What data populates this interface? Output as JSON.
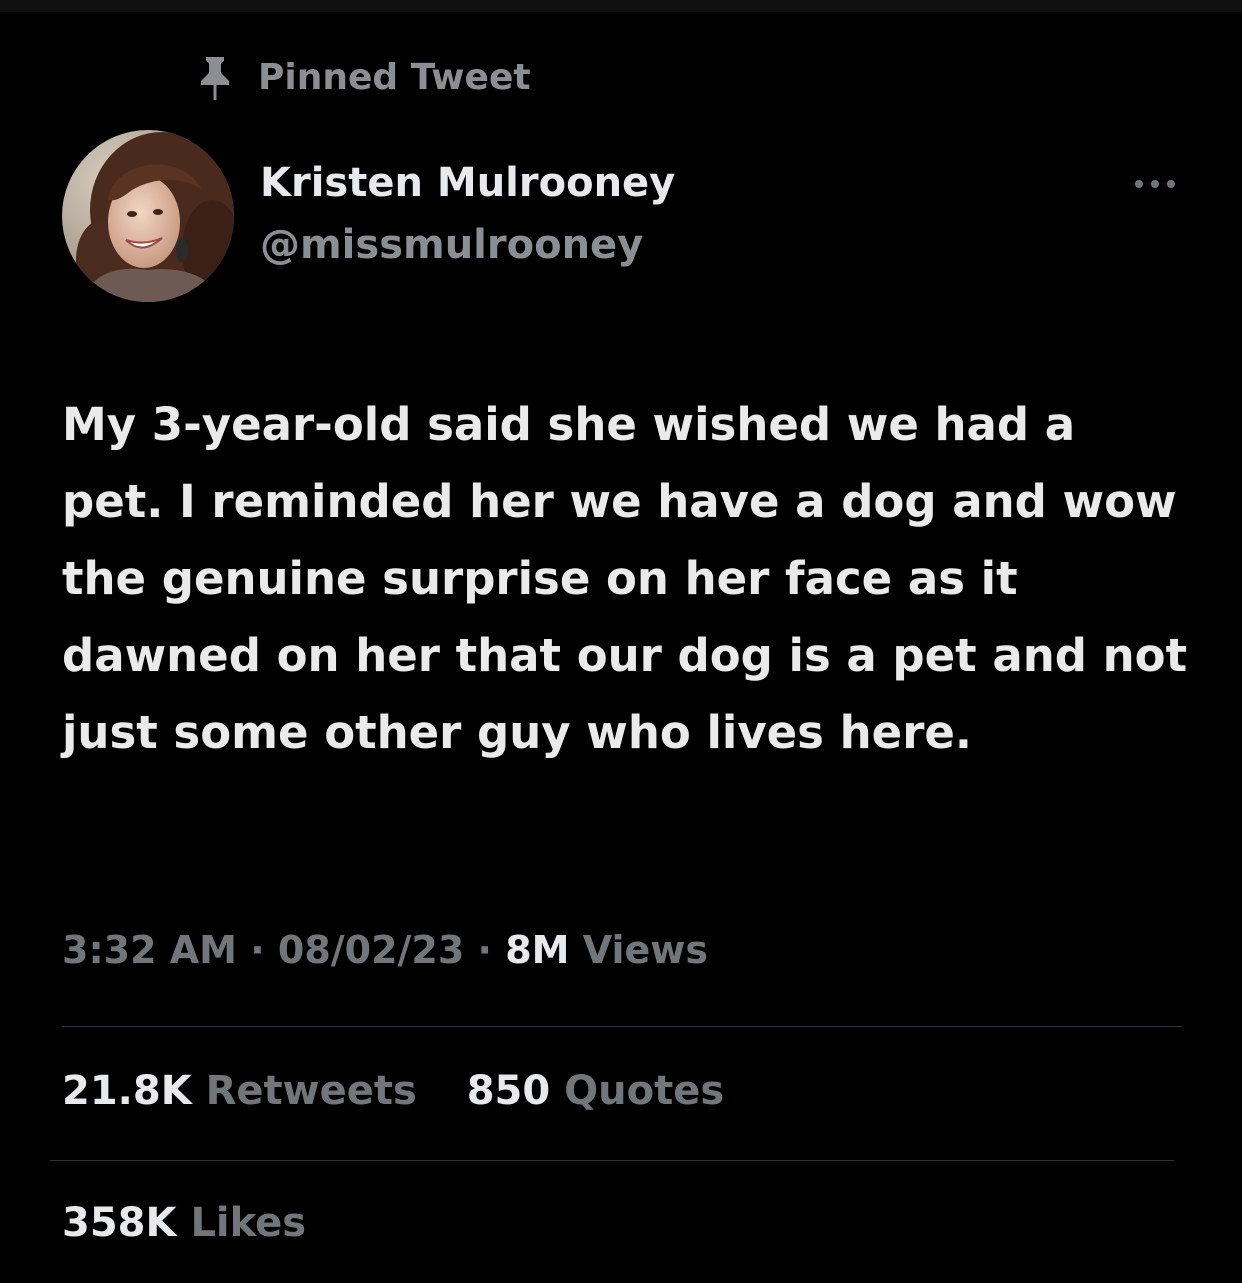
{
  "pinned": {
    "label": "Pinned Tweet",
    "icon": "pin-icon"
  },
  "author": {
    "name": "Kristen Mulrooney",
    "handle": "@missmulrooney",
    "avatar": "avatar-photo"
  },
  "more_icon": "more-icon",
  "tweet": {
    "text": "My 3-year-old said she wished we had a pet. I reminded her we have a dog and wow the genuine surprise on her face as it dawned on her that our dog is a pet and not just some other guy who lives here."
  },
  "meta": {
    "time": "3:32 AM",
    "separator": "·",
    "date": "08/02/23",
    "views_count": "8M",
    "views_label": "Views"
  },
  "stats": {
    "retweets_count": "21.8K",
    "retweets_label": "Retweets",
    "quotes_count": "850",
    "quotes_label": "Quotes",
    "likes_count": "358K",
    "likes_label": "Likes"
  },
  "colors": {
    "background": "#000000",
    "primary_text": "#e7e9ea",
    "secondary_text": "#71767b",
    "divider": "#2f3336"
  }
}
